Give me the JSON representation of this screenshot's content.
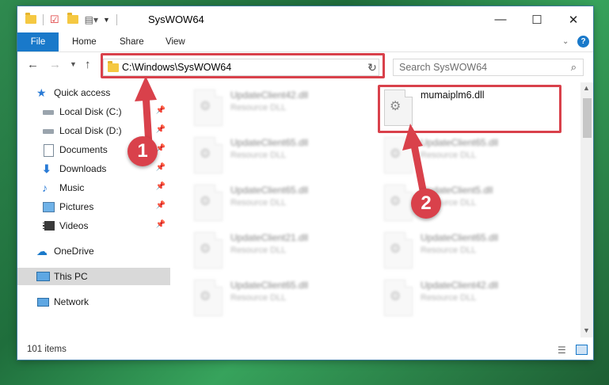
{
  "window": {
    "title": "SysWOW64",
    "minimize_glyph": "—",
    "maximize_glyph": "☐",
    "close_glyph": "✕"
  },
  "ribbon": {
    "tabs": [
      "File",
      "Home",
      "Share",
      "View"
    ],
    "help_glyph": "?"
  },
  "address": {
    "path": "C:\\Windows\\SysWOW64",
    "search_placeholder": "Search SysWOW64"
  },
  "nav": {
    "items": [
      {
        "label": "Quick access",
        "icon": "star-icon",
        "pinned": false
      },
      {
        "label": "Local Disk (C:)",
        "icon": "drive-icon",
        "pinned": true
      },
      {
        "label": "Local Disk (D:)",
        "icon": "drive-icon",
        "pinned": true
      },
      {
        "label": "Documents",
        "icon": "documents-icon",
        "pinned": true
      },
      {
        "label": "Downloads",
        "icon": "download-arrow-icon",
        "pinned": true
      },
      {
        "label": "Music",
        "icon": "music-note-icon",
        "pinned": true
      },
      {
        "label": "Pictures",
        "icon": "pictures-icon",
        "pinned": true
      },
      {
        "label": "Videos",
        "icon": "film-icon",
        "pinned": true
      },
      {
        "label": "OneDrive",
        "icon": "cloud-icon",
        "pinned": false
      },
      {
        "label": "This PC",
        "icon": "monitor-icon",
        "pinned": false,
        "selected": true
      },
      {
        "label": "Network",
        "icon": "network-icon",
        "pinned": false
      }
    ]
  },
  "files": {
    "left": [
      {
        "name": "UpdateClient42.dll",
        "type": "Resource DLL"
      },
      {
        "name": "UpdateClient65.dll",
        "type": "Resource DLL"
      },
      {
        "name": "UpdateClient65.dll",
        "type": "Resource DLL"
      },
      {
        "name": "UpdateClient21.dll",
        "type": "Resource DLL"
      },
      {
        "name": "UpdateClient65.dll",
        "type": "Resource DLL"
      }
    ],
    "right": [
      {
        "name": "mumaiplm6.dll",
        "type": ""
      },
      {
        "name": "UpdateClient65.dll",
        "type": "Resource DLL"
      },
      {
        "name": "UpdateClient5.dll",
        "type": "Resource DLL"
      },
      {
        "name": "UpdateClient65.dll",
        "type": "Resource DLL"
      },
      {
        "name": "UpdateClient42.dll",
        "type": "Resource DLL"
      }
    ]
  },
  "status": {
    "item_count": "101 items"
  },
  "annotations": {
    "marker1": "1",
    "marker2": "2",
    "color": "#d9414b"
  }
}
